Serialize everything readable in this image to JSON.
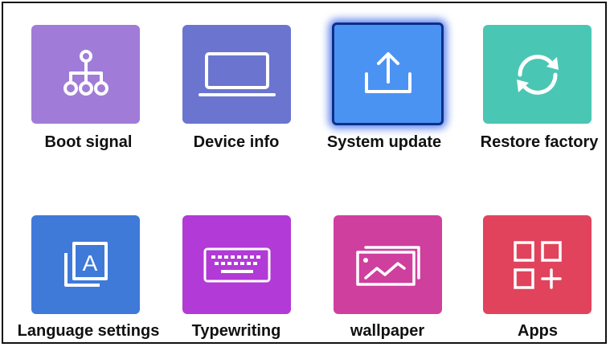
{
  "tiles": [
    {
      "label": "Boot signal",
      "icon": "boot-signal-icon",
      "color": "#a07cd8"
    },
    {
      "label": "Device info",
      "icon": "laptop-icon",
      "color": "#6b74cf"
    },
    {
      "label": "System update",
      "icon": "upload-icon",
      "color": "#4b93f2",
      "selected": true
    },
    {
      "label": "Restore factory",
      "icon": "sync-icon",
      "color": "#4ac6b4"
    },
    {
      "label": "Language settings",
      "icon": "language-a-icon",
      "color": "#3f7ad9"
    },
    {
      "label": "Typewriting",
      "icon": "keyboard-icon",
      "color": "#b23ad6"
    },
    {
      "label": "wallpaper",
      "icon": "wallpaper-icon",
      "color": "#cf3f9e"
    },
    {
      "label": "Apps",
      "icon": "apps-grid-icon",
      "color": "#e1435c"
    }
  ]
}
